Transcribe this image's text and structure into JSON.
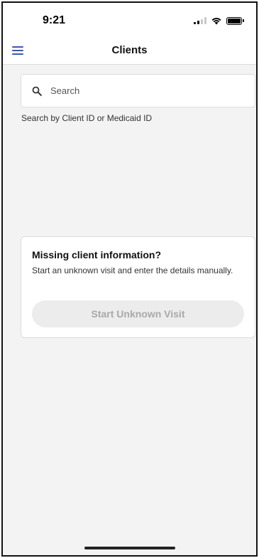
{
  "status_bar": {
    "time": "9:21",
    "icons": [
      "signal-icon",
      "wifi-icon",
      "battery-icon"
    ]
  },
  "header": {
    "title": "Clients",
    "menu_icon": "hamburger-menu-icon"
  },
  "search": {
    "placeholder": "Search",
    "value": "",
    "helper": "Search by Client ID or Medicaid ID",
    "icon": "search-icon"
  },
  "missing_card": {
    "title": "Missing client information?",
    "description": "Start an unknown visit and enter the details manually.",
    "button_label": "Start Unknown Visit"
  },
  "colors": {
    "accent": "#3b5aa8",
    "background": "#f3f3f3",
    "disabled_button": "#ececec",
    "disabled_text": "#a9a9a9"
  }
}
